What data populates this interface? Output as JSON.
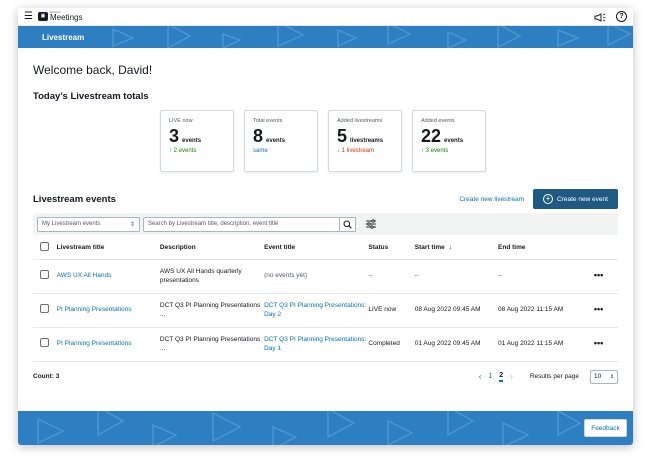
{
  "app": {
    "logo_small": "amazon",
    "logo_name": "Meetings"
  },
  "banner": {
    "title": "Livestream"
  },
  "welcome": "Welcome back, David!",
  "totals": {
    "heading": "Today’s Livestream totals",
    "cards": [
      {
        "label": "LIVE now",
        "value": "3",
        "unit": "events",
        "delta": "2 events",
        "trend": "up"
      },
      {
        "label": "Total events",
        "value": "8",
        "unit": "events",
        "delta": "same",
        "trend": "same"
      },
      {
        "label": "Added livestreams",
        "value": "5",
        "unit": "livestreams",
        "delta": "1 livestream",
        "trend": "down"
      },
      {
        "label": "Added events",
        "value": "22",
        "unit": "events",
        "delta": "3 events",
        "trend": "up"
      }
    ]
  },
  "events": {
    "heading": "Livestream events",
    "create_livestream_link": "Create new livestream",
    "create_event_button": "Create new event",
    "filter_select": "My Livestream events",
    "search_placeholder": "Search by Livestream title, description, event title",
    "columns": {
      "title": "Livestream title",
      "description": "Description",
      "event_title": "Event title",
      "status": "Status",
      "start": "Start time",
      "end": "End time"
    },
    "rows": [
      {
        "title": "AWS UX All Hands",
        "description": "AWS UX All Hands quarterly presentations",
        "event_title": "(no events yet)",
        "status": "--",
        "start": "--",
        "end": "--"
      },
      {
        "title": "PI Planning Presentations",
        "description": "DCT Q3 PI Planning Presentations ...",
        "event_title": "DCT Q3 PI Planning Presentations: Day 2",
        "status": "LIVE now",
        "start": "08 Aug 2022 09:45 AM",
        "end": "08 Aug 2022 11:15 AM"
      },
      {
        "title": "PI Planning Presentations",
        "description": "DCT Q3 PI Planning Presentations ...",
        "event_title": "DCT Q3 PI Planning Presentations: Day 1",
        "status": "Completed",
        "start": "01 Aug 2022 09:45 AM",
        "end": "01 Aug 2022 11:15 AM"
      }
    ],
    "count": "Count: 3",
    "pages": [
      "1",
      "2"
    ],
    "active_page": "2",
    "rows_per_page_label": "Results per page",
    "rows_per_page": "10"
  },
  "feedback_button": "Feedback",
  "colors": {
    "brand_blue": "#2d7fc1",
    "primary_button": "#1f5a84",
    "link": "#0073bb",
    "up": "#1d8102",
    "down": "#d13212"
  }
}
